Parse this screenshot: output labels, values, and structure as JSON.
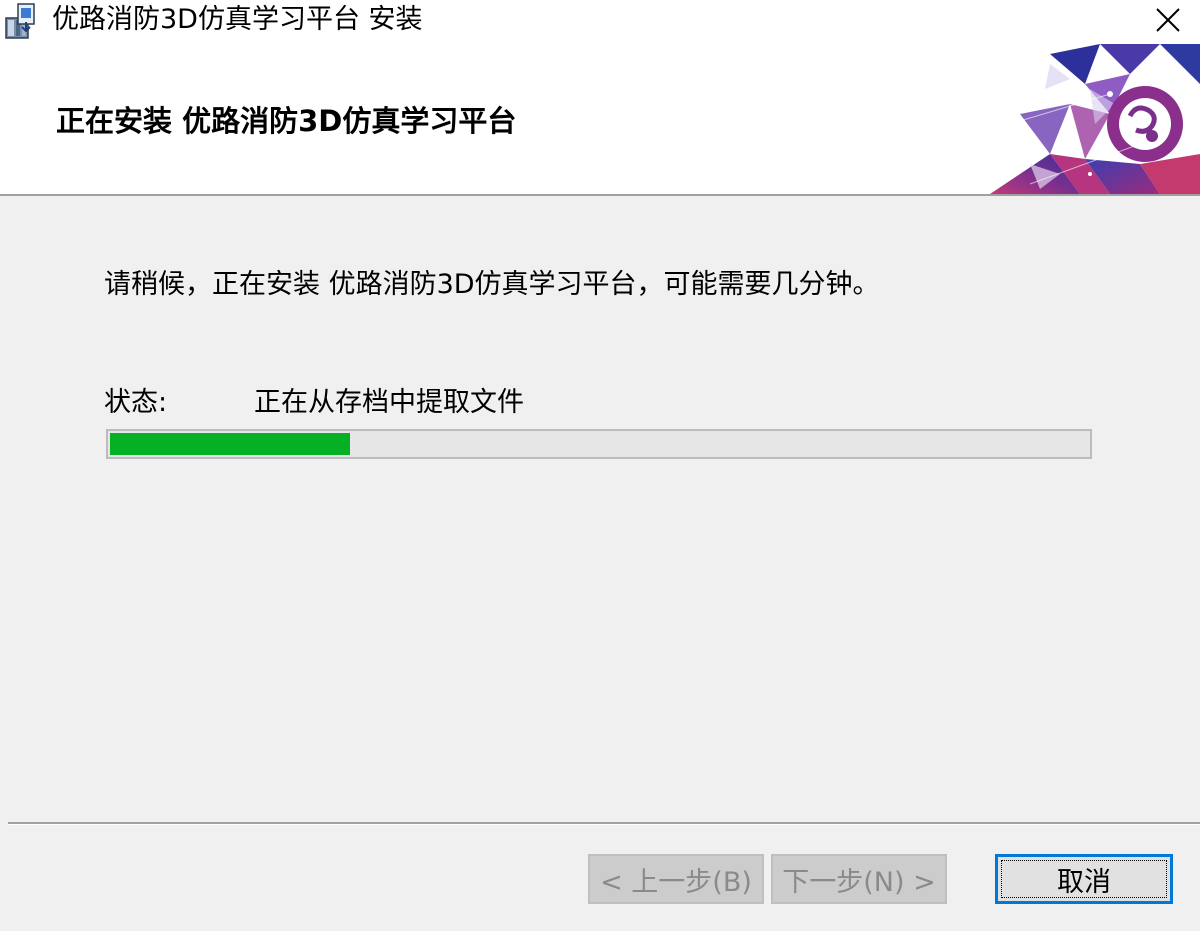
{
  "window": {
    "title": "优路消防3D仿真学习平台 安装",
    "close_glyph": "✕"
  },
  "header": {
    "title": "正在安装 优路消防3D仿真学习平台"
  },
  "body": {
    "message": "请稍候，正在安装 优路消防3D仿真学习平台，可能需要几分钟。",
    "status_label": "状态:",
    "status_value": "正在从存档中提取文件",
    "progress_fraction": 0.245
  },
  "buttons": {
    "back": "< 上一步(B)",
    "next": "下一步(N) >",
    "cancel": "取消"
  },
  "colors": {
    "progress": "#06b025",
    "focus_border": "#0078d7"
  },
  "icons": {
    "app": "installer-package-icon",
    "close": "close-icon",
    "logo": "banner-logo-graphic"
  }
}
